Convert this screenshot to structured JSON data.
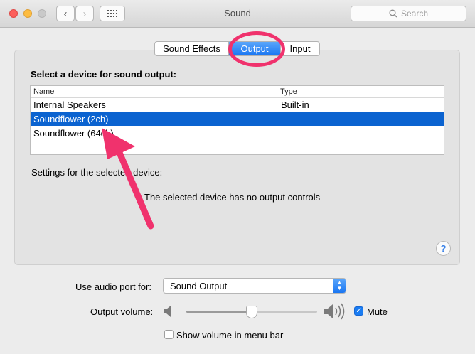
{
  "window": {
    "title": "Sound"
  },
  "toolbar": {
    "back_icon": "chevron-left-icon",
    "forward_icon": "chevron-right-icon",
    "grid_icon": "grid-icon"
  },
  "search": {
    "placeholder": "Search"
  },
  "tabs": [
    {
      "label": "Sound Effects",
      "selected": false
    },
    {
      "label": "Output",
      "selected": true
    },
    {
      "label": "Input",
      "selected": false
    }
  ],
  "output": {
    "heading": "Select a device for sound output:",
    "columns": [
      "Name",
      "Type"
    ],
    "devices": [
      {
        "name": "Internal Speakers",
        "type": "Built-in",
        "selected": false
      },
      {
        "name": "Soundflower (2ch)",
        "type": "",
        "selected": true
      },
      {
        "name": "Soundflower (64ch)",
        "type": "",
        "selected": false
      }
    ],
    "settings_label": "Settings for the selected device:",
    "no_controls_message": "The selected device has no output controls",
    "help_label": "?"
  },
  "audio_port": {
    "label": "Use audio port for:",
    "value": "Sound Output"
  },
  "volume": {
    "label": "Output volume:",
    "level": 0.5,
    "mute_label": "Mute",
    "muted": true
  },
  "menu_bar": {
    "label": "Show volume in menu bar",
    "checked": false
  },
  "colors": {
    "accent": "#1a76f2",
    "selection": "#0b63d0",
    "annotation": "#f0326d"
  }
}
